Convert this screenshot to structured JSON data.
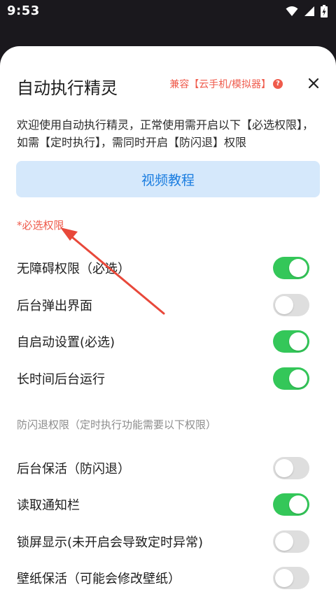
{
  "status_bar": {
    "time": "9:53",
    "icons": [
      "wifi-icon",
      "signal-icon",
      "battery-charging-icon"
    ]
  },
  "sheet": {
    "title": "自动执行精灵",
    "compat_link": "兼容【云手机/模拟器】",
    "help_icon_glyph": "?",
    "close_icon": "close-icon",
    "intro": "欢迎使用自动执行精灵，正常使用需开启以下【必选权限】，如需【定时执行】，需同时开启【防闪退】权限",
    "video_button": "视频教程",
    "required_section": {
      "title": "*必选权限",
      "items": [
        {
          "label": "无障碍权限（必选）",
          "enabled": true
        },
        {
          "label": "后台弹出界面",
          "enabled": false
        },
        {
          "label": "自启动设置(必选)",
          "enabled": true
        },
        {
          "label": "长时间后台运行",
          "enabled": true
        }
      ]
    },
    "optional_section": {
      "title": "防闪退权限（定时执行功能需要以下权限）",
      "items": [
        {
          "label": "后台保活（防闪退）",
          "enabled": false
        },
        {
          "label": "读取通知栏",
          "enabled": true
        },
        {
          "label": "锁屏显示(未开启会导致定时异常)",
          "enabled": false
        },
        {
          "label": "壁纸保活（可能会修改壁纸）",
          "enabled": false
        }
      ]
    }
  },
  "colors": {
    "accent_red": "#ef5b4c",
    "toggle_on": "#34c759",
    "toggle_off": "#dedede",
    "video_button_bg": "#d5e8fb",
    "video_button_text": "#1a7de0"
  }
}
